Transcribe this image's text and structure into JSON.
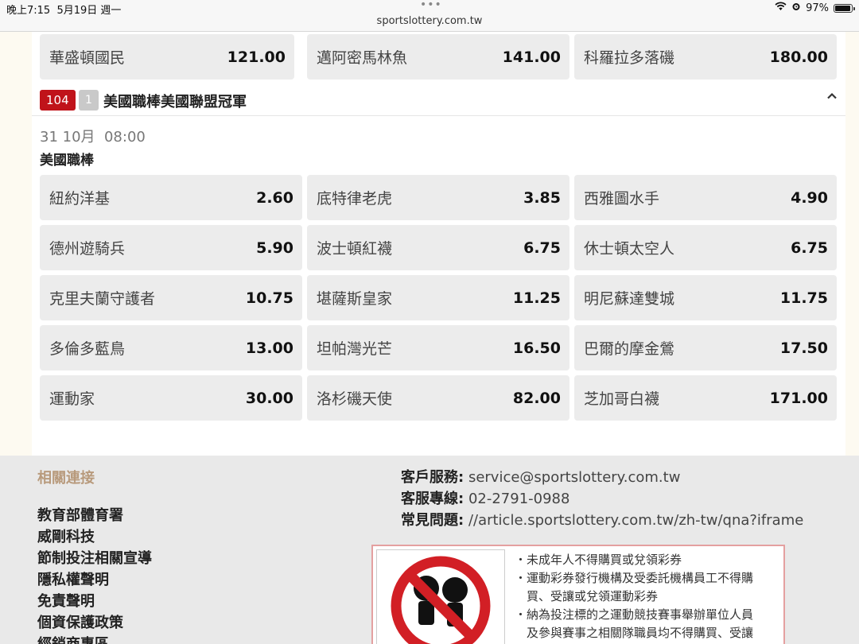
{
  "status": {
    "time": "晚上7:15  5月19日 週一",
    "url": "sportslottery.com.tw",
    "battery": "97%",
    "battery_level": 0.97
  },
  "top_row": [
    {
      "name": "華盛頓國民",
      "odds": "121.00"
    },
    {
      "name": "邁阿密馬林魚",
      "odds": "141.00"
    },
    {
      "name": "科羅拉多落磯",
      "odds": "180.00"
    }
  ],
  "market": {
    "id_badge": "104",
    "count_badge": "1",
    "title": "美國職棒美國聯盟冠軍",
    "date": "31 10月  08:00",
    "league": "美國職棒",
    "selections": [
      {
        "name": "紐約洋基",
        "odds": "2.60"
      },
      {
        "name": "底特律老虎",
        "odds": "3.85"
      },
      {
        "name": "西雅圖水手",
        "odds": "4.90"
      },
      {
        "name": "德州遊騎兵",
        "odds": "5.90"
      },
      {
        "name": "波士頓紅襪",
        "odds": "6.75"
      },
      {
        "name": "休士頓太空人",
        "odds": "6.75"
      },
      {
        "name": "克里夫蘭守護者",
        "odds": "10.75"
      },
      {
        "name": "堪薩斯皇家",
        "odds": "11.25"
      },
      {
        "name": "明尼蘇達雙城",
        "odds": "11.75"
      },
      {
        "name": "多倫多藍鳥",
        "odds": "13.00"
      },
      {
        "name": "坦帕灣光芒",
        "odds": "16.50"
      },
      {
        "name": "巴爾的摩金鶯",
        "odds": "17.50"
      },
      {
        "name": "運動家",
        "odds": "30.00"
      },
      {
        "name": "洛杉磯天使",
        "odds": "82.00"
      },
      {
        "name": "芝加哥白襪",
        "odds": "171.00"
      }
    ]
  },
  "footer": {
    "links_title": "相關連接",
    "links": [
      "教育部體育署",
      "威剛科技",
      "節制投注相關宣導",
      "隱私權聲明",
      "免責聲明",
      "個資保護政策",
      "經銷商專區"
    ],
    "contact": [
      {
        "label": "客戶服務:",
        "value": "service@sportslottery.com.tw"
      },
      {
        "label": "客服專線:",
        "value": "02-2791-0988"
      },
      {
        "label": "常見問題:",
        "value": "//article.sportslottery.com.tw/zh-tw/qna?iframe"
      }
    ],
    "notice_lines": [
      "・未成年人不得購買或兌領彩券",
      "・運動彩券發行機構及受委託機構員工不得購",
      "　買、受讓或兌領運動彩券",
      "・納為投注標的之運動競技賽事舉辦單位人員",
      "　及參與賽事之相關隊職員均不得購買、受讓"
    ]
  },
  "colors": {
    "accent_red": "#c0131a",
    "footer_title": "#b89a7c",
    "cell_bg": "#ececec"
  }
}
